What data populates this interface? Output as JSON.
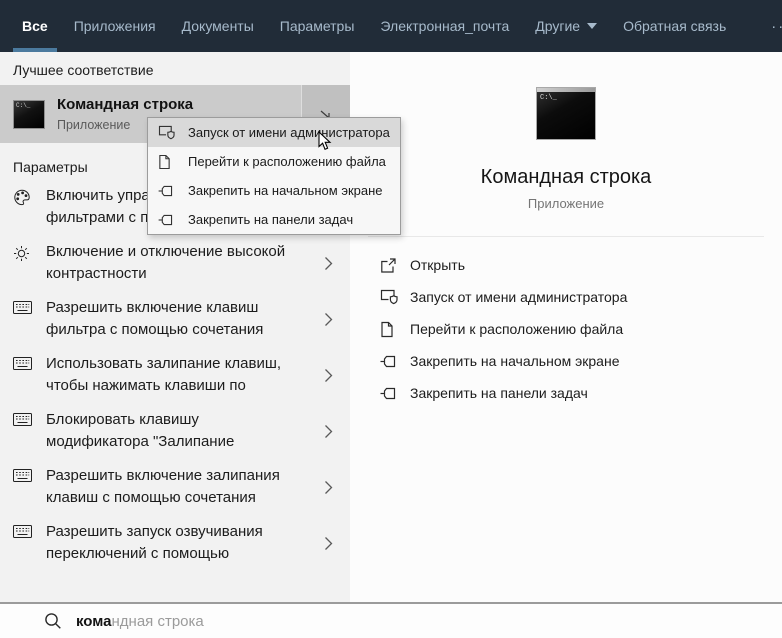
{
  "colors": {
    "header_bg": "#212c38",
    "accent_underline": "#4b7a9e",
    "tab_inactive_text": "#a7bacb",
    "left_panel_bg": "#f2f2f2",
    "best_match_row_bg": "#cbcbcb",
    "menu_highlight_bg": "#d9d9d9"
  },
  "header": {
    "tabs": [
      {
        "label": "Все",
        "active": true
      },
      {
        "label": "Приложения",
        "active": false
      },
      {
        "label": "Документы",
        "active": false
      },
      {
        "label": "Параметры",
        "active": false
      },
      {
        "label": "Электронная_почта",
        "active": false
      },
      {
        "label": "Другие",
        "active": false,
        "dropdown": true
      }
    ],
    "feedback_label": "Обратная связь",
    "more_label": "···"
  },
  "left_panel": {
    "best_match_header": "Лучшее соответствие",
    "best_match": {
      "title": "Командная строка",
      "subtitle": "Приложение",
      "icon_text": "C:\\_"
    },
    "settings_header": "Параметры",
    "settings": [
      {
        "icon": "color-filters-icon",
        "lines": [
          "Включить упра",
          "фильтрами с по"
        ]
      },
      {
        "icon": "contrast-icon",
        "lines": [
          "Включение и отключение высокой",
          "контрастности"
        ]
      },
      {
        "icon": "keyboard-icon",
        "lines": [
          "Разрешить включение клавиш",
          "фильтра с помощью сочетания"
        ]
      },
      {
        "icon": "keyboard-icon",
        "lines": [
          "Использовать залипание клавиш,",
          "чтобы нажимать клавиши по"
        ]
      },
      {
        "icon": "keyboard-icon",
        "lines": [
          "Блокировать клавишу",
          "модификатора \"Залипание"
        ]
      },
      {
        "icon": "keyboard-icon",
        "lines": [
          "Разрешить включение залипания",
          "клавиш с помощью сочетания"
        ]
      },
      {
        "icon": "keyboard-icon",
        "lines": [
          "Разрешить запуск озвучивания",
          "переключений с помощью"
        ]
      }
    ]
  },
  "context_menu": {
    "items": [
      {
        "icon": "run-as-admin-icon",
        "label": "Запуск от имени администратора",
        "highlighted": true
      },
      {
        "icon": "file-location-icon",
        "label": "Перейти к расположению файла",
        "highlighted": false
      },
      {
        "icon": "pin-icon",
        "label": "Закрепить на начальном экране",
        "highlighted": false
      },
      {
        "icon": "pin-icon",
        "label": "Закрепить на панели задач",
        "highlighted": false
      }
    ]
  },
  "right_panel": {
    "app_title": "Командная строка",
    "app_subtitle": "Приложение",
    "app_icon_text": "C:\\_",
    "actions": [
      {
        "icon": "open-icon",
        "label": "Открыть"
      },
      {
        "icon": "run-as-admin-icon",
        "label": "Запуск от имени администратора"
      },
      {
        "icon": "file-location-icon",
        "label": "Перейти к расположению файла"
      },
      {
        "icon": "pin-icon",
        "label": "Закрепить на начальном экране"
      },
      {
        "icon": "pin-icon",
        "label": "Закрепить на панели задач"
      }
    ]
  },
  "search": {
    "typed": "кома",
    "suggestion": "ндная строка"
  }
}
